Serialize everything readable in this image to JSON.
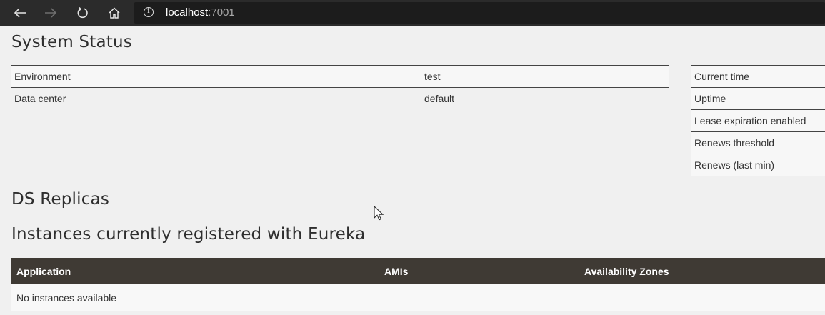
{
  "browser": {
    "url_host": "localhost",
    "url_port": ":7001"
  },
  "system_status": {
    "title": "System Status",
    "left_rows": [
      {
        "label": "Environment",
        "value": "test"
      },
      {
        "label": "Data center",
        "value": "default"
      }
    ],
    "right_rows": [
      "Current time",
      "Uptime",
      "Lease expiration enabled",
      "Renews threshold",
      "Renews (last min)"
    ]
  },
  "ds_replicas": {
    "title": "DS Replicas"
  },
  "instances": {
    "title": "Instances currently registered with Eureka",
    "columns": [
      "Application",
      "AMIs",
      "Availability Zones"
    ],
    "empty_message": "No instances available"
  }
}
